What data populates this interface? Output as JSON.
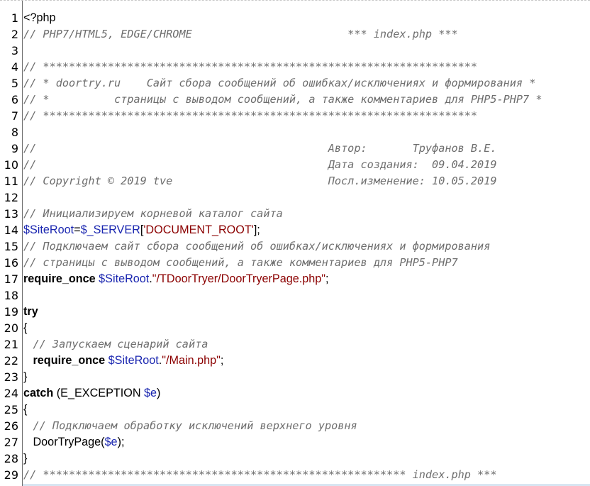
{
  "lines": [
    {
      "n": "1",
      "parts": [
        {
          "t": "plain",
          "s": "<?php"
        }
      ]
    },
    {
      "n": "2",
      "parts": [
        {
          "t": "cm",
          "s": "// PHP7/HTML5, EDGE/CHROME                        *** index.php ***"
        }
      ]
    },
    {
      "n": "3",
      "parts": []
    },
    {
      "n": "4",
      "parts": [
        {
          "t": "cm",
          "s": "// *******************************************************************"
        }
      ]
    },
    {
      "n": "5",
      "parts": [
        {
          "t": "cm",
          "s": "// * doortry.ru    Сайт сбора сообщений об ошибках/исключениях и формирования *"
        }
      ]
    },
    {
      "n": "6",
      "parts": [
        {
          "t": "cm",
          "s": "// *          страницы с выводом сообщений, а также комментариев для PHP5-PHP7 *"
        }
      ]
    },
    {
      "n": "7",
      "parts": [
        {
          "t": "cm",
          "s": "// *******************************************************************"
        }
      ]
    },
    {
      "n": "8",
      "parts": []
    },
    {
      "n": "9",
      "parts": [
        {
          "t": "cm",
          "s": "//                                             Автор:       Труфанов В.Е."
        }
      ]
    },
    {
      "n": "10",
      "parts": [
        {
          "t": "cm",
          "s": "//                                             Дата создания:  09.04.2019"
        }
      ]
    },
    {
      "n": "11",
      "parts": [
        {
          "t": "cm",
          "s": "// Copyright © 2019 tve                        Посл.изменение: 10.05.2019"
        }
      ]
    },
    {
      "n": "12",
      "parts": []
    },
    {
      "n": "13",
      "parts": [
        {
          "t": "cm",
          "s": "// Инициализируем корневой каталог сайта"
        }
      ]
    },
    {
      "n": "14",
      "parts": [
        {
          "t": "var",
          "s": "$SiteRoot"
        },
        {
          "t": "plain",
          "s": "="
        },
        {
          "t": "var",
          "s": "$_SERVER"
        },
        {
          "t": "plain",
          "s": "["
        },
        {
          "t": "str",
          "s": "'DOCUMENT_ROOT'"
        },
        {
          "t": "plain",
          "s": "];"
        }
      ]
    },
    {
      "n": "15",
      "parts": [
        {
          "t": "cm",
          "s": "// Подключаем сайт сбора сообщений об ошибках/исключениях и формирования"
        }
      ]
    },
    {
      "n": "16",
      "parts": [
        {
          "t": "cm",
          "s": "// страницы с выводом сообщений, а также комментариев для PHP5-PHP7"
        }
      ]
    },
    {
      "n": "17",
      "parts": [
        {
          "t": "kw",
          "s": "require_once"
        },
        {
          "t": "plain",
          "s": " "
        },
        {
          "t": "var",
          "s": "$SiteRoot"
        },
        {
          "t": "plain",
          "s": "."
        },
        {
          "t": "str",
          "s": "\"/TDoorTryer/DoorTryerPage.php\""
        },
        {
          "t": "plain",
          "s": ";"
        }
      ]
    },
    {
      "n": "18",
      "parts": []
    },
    {
      "n": "19",
      "parts": [
        {
          "t": "kw",
          "s": "try"
        }
      ]
    },
    {
      "n": "20",
      "parts": [
        {
          "t": "plain",
          "s": "{"
        }
      ]
    },
    {
      "n": "21",
      "parts": [
        {
          "t": "plain",
          "s": "   "
        },
        {
          "t": "cm",
          "s": "// Запускаем сценарий сайта"
        }
      ]
    },
    {
      "n": "22",
      "parts": [
        {
          "t": "plain",
          "s": "   "
        },
        {
          "t": "kw",
          "s": "require_once"
        },
        {
          "t": "plain",
          "s": " "
        },
        {
          "t": "var",
          "s": "$SiteRoot"
        },
        {
          "t": "plain",
          "s": "."
        },
        {
          "t": "str",
          "s": "\"/Main.php\""
        },
        {
          "t": "plain",
          "s": ";"
        }
      ]
    },
    {
      "n": "23",
      "parts": [
        {
          "t": "plain",
          "s": "}"
        }
      ]
    },
    {
      "n": "24",
      "parts": [
        {
          "t": "kw",
          "s": "catch"
        },
        {
          "t": "plain",
          "s": " (E_EXCEPTION "
        },
        {
          "t": "var",
          "s": "$e"
        },
        {
          "t": "plain",
          "s": ")"
        }
      ]
    },
    {
      "n": "25",
      "parts": [
        {
          "t": "plain",
          "s": "{"
        }
      ]
    },
    {
      "n": "26",
      "parts": [
        {
          "t": "plain",
          "s": "   "
        },
        {
          "t": "cm",
          "s": "// Подключаем обработку исключений верхнего уровня"
        }
      ]
    },
    {
      "n": "27",
      "parts": [
        {
          "t": "plain",
          "s": "   DoorTryPage("
        },
        {
          "t": "var",
          "s": "$e"
        },
        {
          "t": "plain",
          "s": ");"
        }
      ]
    },
    {
      "n": "28",
      "parts": [
        {
          "t": "plain",
          "s": "}"
        }
      ]
    },
    {
      "n": "29",
      "parts": [
        {
          "t": "cm",
          "s": "// ******************************************************** index.php ***"
        }
      ]
    }
  ],
  "colors": {
    "comment": "#6e6e6e",
    "variable": "#1a26b0",
    "string": "#8b0000",
    "keyword": "#000000"
  }
}
